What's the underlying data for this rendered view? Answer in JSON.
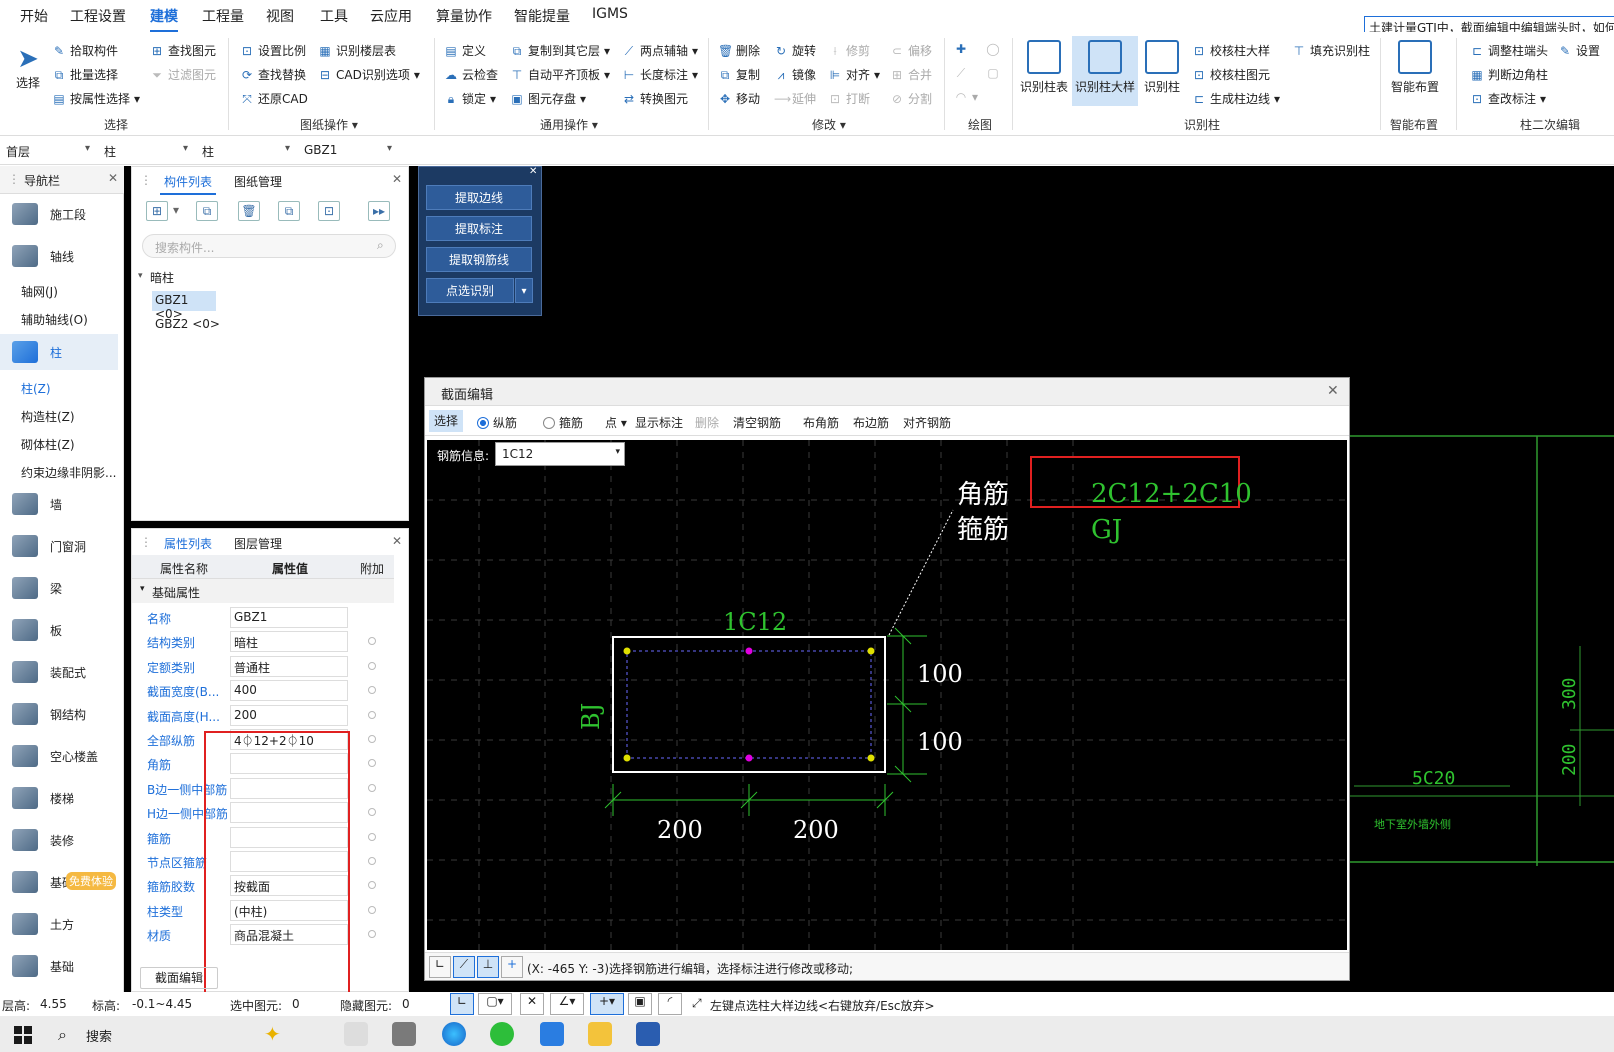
{
  "menu": {
    "items": [
      "开始",
      "工程设置",
      "建模",
      "工程量",
      "视图",
      "工具",
      "云应用",
      "算量协作",
      "智能提量",
      "IGMS"
    ],
    "active": "建模",
    "notice": "土建计量GTJ中，截面编辑中编辑端头时，如何"
  },
  "ribbon": {
    "select_group": {
      "big": "选择",
      "items": [
        "拾取构件",
        "批量选择",
        "按属性选择",
        "查找图元",
        "过滤图元"
      ],
      "title": "选择"
    },
    "drawing_group": {
      "items": [
        "设置比例",
        "识别楼层表",
        "查找替换",
        "CAD识别选项",
        "还原CAD"
      ],
      "title": "图纸操作"
    },
    "common_group": {
      "items": [
        "定义",
        "复制到其它层",
        "两点辅轴",
        "云检查",
        "自动平齐顶板",
        "长度标注",
        "锁定",
        "图元存盘",
        "转换图元"
      ],
      "title": "通用操作"
    },
    "modify_group": {
      "items": [
        "删除",
        "旋转",
        "修剪",
        "偏移",
        "复制",
        "镜像",
        "对齐",
        "合并",
        "移动",
        "延伸",
        "打断",
        "分割"
      ],
      "title": "修改"
    },
    "draw_group": {
      "title": "绘图"
    },
    "recognize_group": {
      "big": [
        "识别柱表",
        "识别柱大样",
        "识别柱"
      ],
      "items": [
        "校核柱大样",
        "填充识别柱",
        "校核柱图元",
        "生成柱边线"
      ],
      "title": "识别柱"
    },
    "smart_group": {
      "big": "智能布置",
      "title": "智能布置"
    },
    "column2_group": {
      "items": [
        "调整柱端头",
        "设置",
        "判断边角柱",
        "查改标注"
      ],
      "title": "柱二次编辑"
    }
  },
  "selectors": {
    "floor": "首层",
    "category": "柱",
    "subcategory": "柱",
    "component": "GBZ1"
  },
  "nav": {
    "title": "导航栏",
    "items": [
      {
        "label": "施工段"
      },
      {
        "label": "轴线"
      },
      {
        "label": "柱"
      },
      {
        "label": "墙"
      },
      {
        "label": "门窗洞"
      },
      {
        "label": "梁"
      },
      {
        "label": "板"
      },
      {
        "label": "装配式"
      },
      {
        "label": "钢结构"
      },
      {
        "label": "空心楼盖"
      },
      {
        "label": "楼梯"
      },
      {
        "label": "装修"
      },
      {
        "label": "基础"
      },
      {
        "label": "土方"
      },
      {
        "label": "基础"
      }
    ],
    "subitems_axis": [
      "轴网(J)",
      "辅助轴线(O)"
    ],
    "subitems_col": [
      "柱(Z)",
      "构造柱(Z)",
      "砌体柱(Z)",
      "约束边缘非阴影..."
    ],
    "badge": "免费体验"
  },
  "comp_panel": {
    "tabs": [
      "构件列表",
      "图纸管理"
    ],
    "search_placeholder": "搜索构件...",
    "tree_root": "暗柱",
    "tree_items": [
      "GBZ1 <0>",
      "GBZ2 <0>"
    ]
  },
  "prop_panel": {
    "tabs": [
      "属性列表",
      "图层管理"
    ],
    "headers": [
      "属性名称",
      "属性值",
      "附加"
    ],
    "group": "基础属性",
    "rows": [
      {
        "name": "名称",
        "value": "GBZ1"
      },
      {
        "name": "结构类别",
        "value": "暗柱"
      },
      {
        "name": "定额类别",
        "value": "普通柱"
      },
      {
        "name": "截面宽度(B...",
        "value": "400"
      },
      {
        "name": "截面高度(H...",
        "value": "200"
      },
      {
        "name": "全部纵筋",
        "value": "4⏀12+2⏀10"
      },
      {
        "name": "角筋",
        "value": ""
      },
      {
        "name": "B边一侧中部筋",
        "value": ""
      },
      {
        "name": "H边一侧中部筋",
        "value": ""
      },
      {
        "name": "箍筋",
        "value": ""
      },
      {
        "name": "节点区箍筋",
        "value": ""
      },
      {
        "name": "箍筋胶数",
        "value": "按截面"
      },
      {
        "name": "柱类型",
        "value": "(中柱)"
      },
      {
        "name": "材质",
        "value": "商品混凝土"
      }
    ],
    "bottom_button": "截面编辑"
  },
  "float_panel": {
    "buttons": [
      "提取边线",
      "提取标注",
      "提取钢筋线",
      "点选识别"
    ]
  },
  "dialog": {
    "title": "截面编辑",
    "toolbar": [
      "选择",
      "纵筋",
      "箍筋",
      "点",
      "显示标注",
      "删除",
      "清空钢筋",
      "布角筋",
      "布边筋",
      "对齐钢筋"
    ],
    "rebar_label": "钢筋信息:",
    "rebar_value": "1C12",
    "cad": {
      "corner_label": "角筋",
      "stirrup_label": "箍筋",
      "spec": "2C12+2C10",
      "gj": "GJ",
      "top": "1C12",
      "bj": "BJ",
      "dim_h1": "100",
      "dim_h2": "100",
      "dim_w1": "200",
      "dim_w2": "200"
    },
    "status": "(X: -465 Y: -3)选择钢筋进行编辑，选择标注进行修改或移动;"
  },
  "bg_cad": {
    "d300": "300",
    "d200": "200",
    "rebar": "5C20",
    "note": "地下室外墙外侧"
  },
  "status": {
    "floor_h_label": "层高:",
    "floor_h": "4.55",
    "elev_label": "标高:",
    "elev": "-0.1~4.45",
    "selected_label": "选中图元:",
    "selected": "0",
    "hidden_label": "隐藏图元:",
    "hidden": "0",
    "hint": "左键点选柱大样边线<右键放弃/Esc放弃>"
  },
  "taskbar": {
    "search": "搜索"
  }
}
